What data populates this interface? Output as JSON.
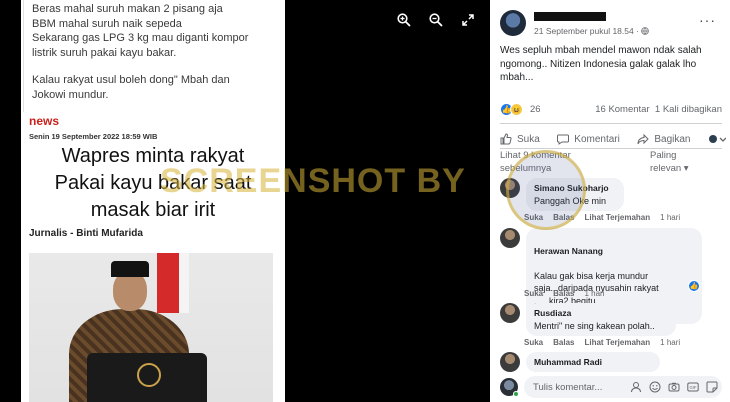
{
  "post_image": {
    "text_paragraph_1": "Beras mahal suruh makan 2 pisang aja\nBBM mahal suruh naik sepeda\nSekarang gas LPG 3 kg mau diganti kompor\nlistrik suruh pakai kayu bakar.",
    "text_paragraph_2": "Kalau rakyat usul boleh dong\" Mbah dan\nJokowi mundur.",
    "news_logo": "news",
    "news_date": "Senin 19 September 2022 18:59 WIB",
    "headline": "Wapres minta rakyat\nPakai kayu bakar saat\nmasak biar irit",
    "author": "Jurnalis - Binti Mufarida",
    "watermark": "SCREENSHOT BY"
  },
  "viewer_tools": [
    "zoom-in-icon",
    "zoom-out-icon",
    "fullscreen-icon"
  ],
  "post": {
    "timestamp": "21 September pukul 18.54 · ",
    "more_label": "···",
    "caption": "Wes sepluh mbah mendel mawon ndak salah ngomong.. Nitizen Indonesia galak galak lho mbah...",
    "reaction_count": "26",
    "comment_count": "16 Komentar",
    "share_count": "1 Kali dibagikan",
    "actions": {
      "like": "Suka",
      "comment": "Komentari",
      "share": "Bagikan"
    },
    "prev_comments": "Lihat 9 komentar\nsebelumnya",
    "sort_label": "Paling\nrelevan ▾"
  },
  "comments": [
    {
      "name": "Simano Sukoharjo",
      "text": "Panggah Oke min",
      "like": "Suka",
      "reply": "Balas",
      "translate": "Lihat Terjemahan",
      "time": "1 hari"
    },
    {
      "name": "Herawan Nanang",
      "text": "Kalau gak bisa kerja mundur\nsaja...daripada nyusahin rakyat\n......kira2 begitu....",
      "like": "Suka",
      "reply": "Balas",
      "time": "1 hari"
    },
    {
      "name": "Rusdiaza",
      "text": "Mentri\" ne sing kakean polah..",
      "like": "Suka",
      "reply": "Balas",
      "translate": "Lihat Terjemahan",
      "time": "1 hari"
    },
    {
      "name": "Muhammad Radi",
      "text": ""
    }
  ],
  "composer": {
    "placeholder": "Tulis komentar..."
  },
  "colors": {
    "facebook_blue": "#1877f2",
    "news_red": "#c9231e",
    "watermark_gold": "#d6b237",
    "bubble_bg": "#f0f2f5"
  }
}
